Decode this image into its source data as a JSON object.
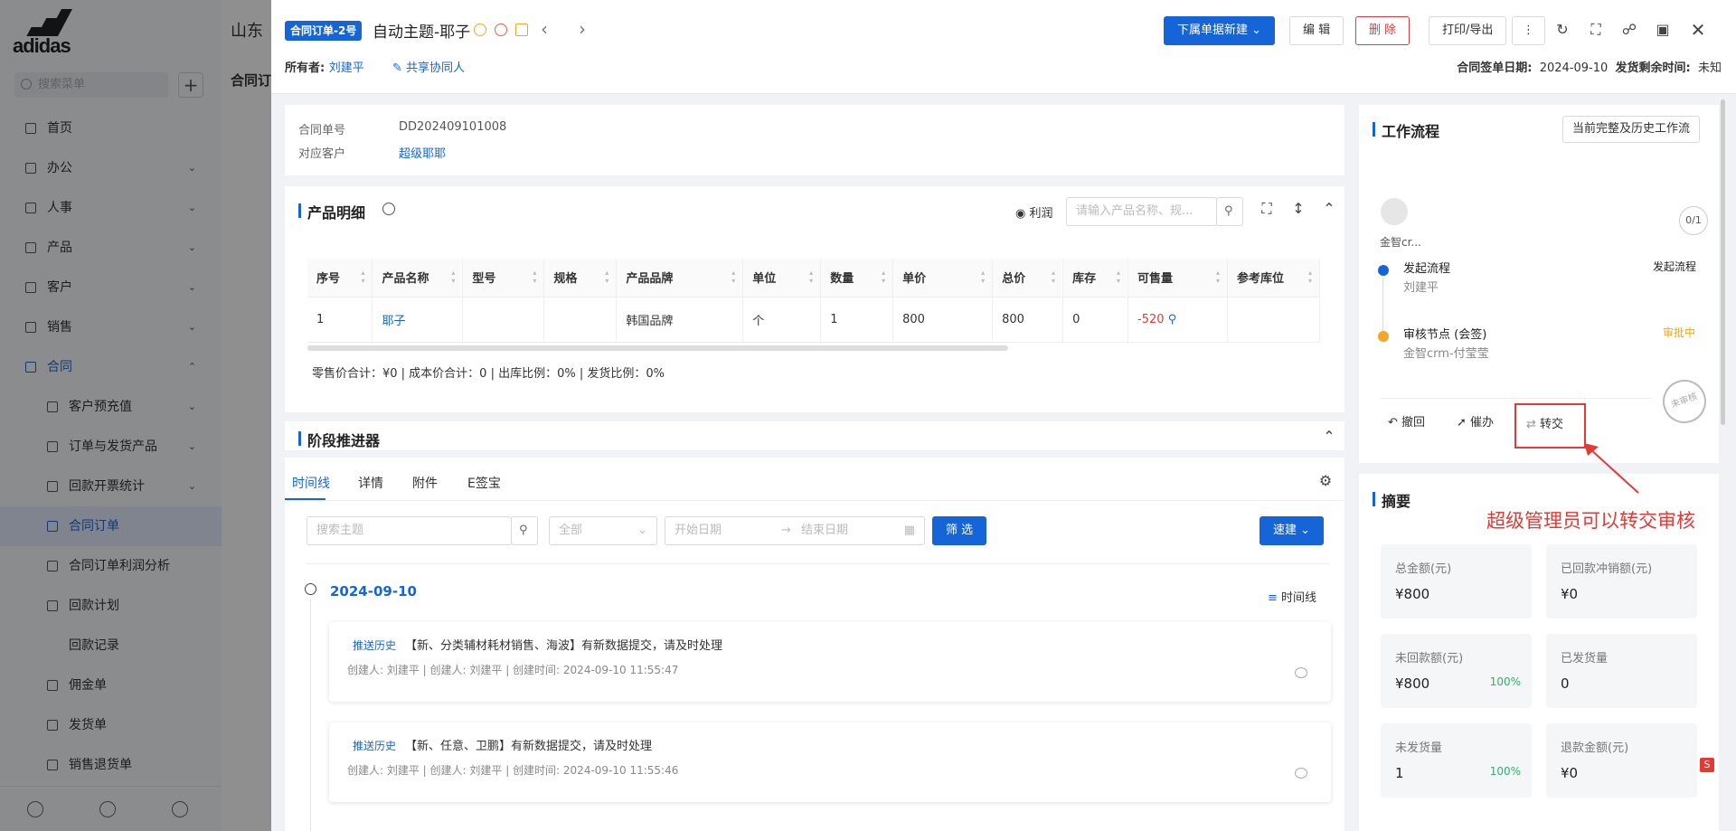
{
  "sidebar": {
    "brand": "adidas",
    "search_placeholder": "搜索菜单",
    "items": [
      {
        "label": "首页"
      },
      {
        "label": "办公"
      },
      {
        "label": "人事"
      },
      {
        "label": "产品"
      },
      {
        "label": "客户"
      },
      {
        "label": "销售"
      },
      {
        "label": "合同"
      },
      {
        "label": "客户预充值"
      },
      {
        "label": "订单与发货产品"
      },
      {
        "label": "回款开票统计"
      },
      {
        "label": "合同订单"
      },
      {
        "label": "合同订单利润分析"
      },
      {
        "label": "回款计划"
      },
      {
        "label": "回款记录"
      },
      {
        "label": "佣金单"
      },
      {
        "label": "发货单"
      },
      {
        "label": "销售退货单"
      }
    ]
  },
  "background": {
    "title_partial": "山东",
    "list_title_partial": "合同订"
  },
  "header": {
    "tag": "合同订单-2号",
    "title": "自动主题-耶子",
    "owner_label": "所有者:",
    "owner_value": "刘建平",
    "share_label": "共享协同人",
    "sign_date_label": "合同签单日期:",
    "sign_date": "2024-09-10",
    "ship_remain_label": "发货剩余时间:",
    "ship_remain": "未知",
    "btn_new_sub": "下属单据新建",
    "btn_edit": "编 辑",
    "btn_delete": "删 除",
    "btn_print": "打印/导出"
  },
  "info": {
    "order_no_label": "合同单号",
    "order_no": "DD202409101008",
    "customer_label": "对应客户",
    "customer": "超级耶耶"
  },
  "products": {
    "title": "产品明细",
    "profit_label": "利润",
    "search_placeholder": "请输入产品名称、规...",
    "columns": [
      "序号",
      "产品名称",
      "型号",
      "规格",
      "产品品牌",
      "单位",
      "数量",
      "单价",
      "总价",
      "库存",
      "可售量",
      "参考库位"
    ],
    "rows": [
      {
        "no": "1",
        "name": "耶子",
        "model": "",
        "spec": "",
        "brand": "韩国品牌",
        "unit": "个",
        "qty": "1",
        "price": "800",
        "total": "800",
        "stock": "0",
        "sellable": "-520",
        "loc": ""
      }
    ],
    "summary": "零售价合计：¥0 |   成本价合计：0 |   出库比例：0% |   发货比例：0%"
  },
  "stage": {
    "title": "阶段推进器",
    "tabs": [
      "时间线",
      "详情",
      "附件",
      "E签宝"
    ],
    "search_placeholder": "搜索主题",
    "scope": "全部",
    "start_placeholder": "开始日期",
    "end_placeholder": "结束日期",
    "filter_btn": "筛 选",
    "quick_btn": "速建",
    "date": "2024-09-10",
    "timeline_label": "时间线",
    "entries": [
      {
        "tag": "推送历史",
        "text": "【新、分类辅材耗材销售、海波】有新数据提交，请及时处理",
        "meta": "创建人: 刘建平  |  创建人: 刘建平  |  创建时间: 2024-09-10 11:55:47"
      },
      {
        "tag": "推送历史",
        "text": "【新、任意、卫鹏】有新数据提交，请及时处理",
        "meta": "创建人: 刘建平  |  创建人: 刘建平  |  创建时间: 2024-09-10 11:55:46"
      }
    ]
  },
  "workflow": {
    "title": "工作流程",
    "history_btn": "当前完整及历史工作流",
    "user": "金智cr...",
    "count": "0/1",
    "step1_title": "发起流程",
    "step1_user": "刘建平",
    "step1_status": "发起流程",
    "step2_title": "审核节点 (会签)",
    "step2_user": "金智crm-付莹莹",
    "step2_status": "审批中",
    "stamp": "未审核",
    "withdraw": "撤回",
    "urge": "催办",
    "transfer": "转交"
  },
  "summary": {
    "title": "摘要",
    "boxes": [
      {
        "label": "总金额(元)",
        "value": "¥800",
        "pct": ""
      },
      {
        "label": "已回款冲销额(元)",
        "value": "¥0",
        "pct": ""
      },
      {
        "label": "未回款额(元)",
        "value": "¥800",
        "pct": "100%"
      },
      {
        "label": "已发货量",
        "value": "0",
        "pct": ""
      },
      {
        "label": "未发货量",
        "value": "1",
        "pct": "100%"
      },
      {
        "label": "退款金额(元)",
        "value": "¥0",
        "pct": ""
      }
    ]
  },
  "annotation": "超级管理员可以转交审核",
  "colors": {
    "primary": "#1565d8",
    "danger": "#e53935",
    "warning": "#f5a623",
    "success": "#2ab368"
  }
}
